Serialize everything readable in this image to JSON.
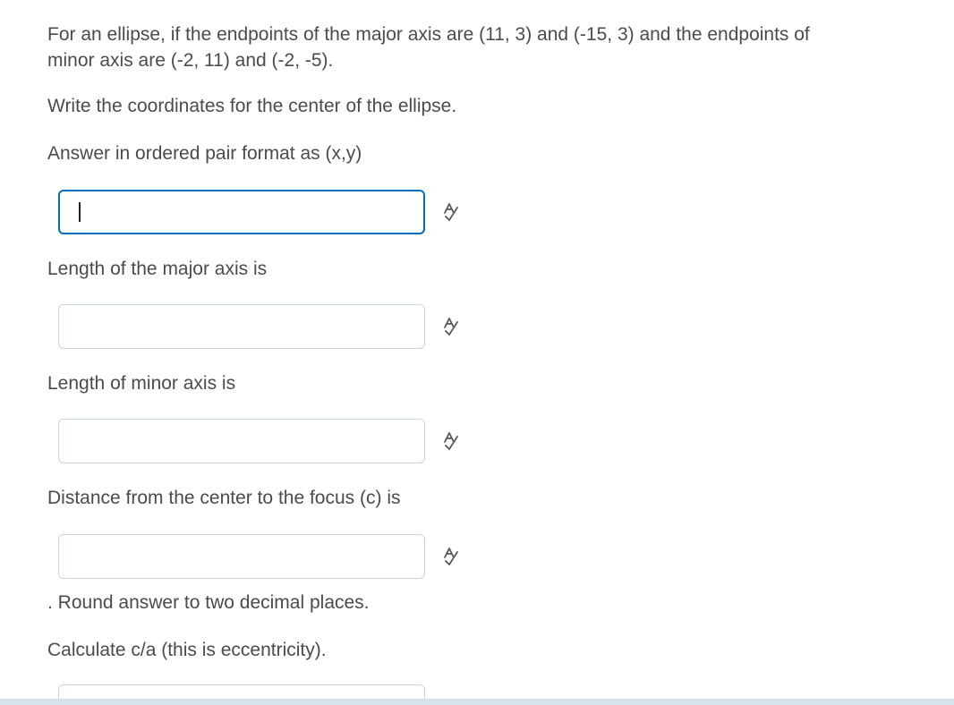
{
  "question": {
    "intro": "For an ellipse, if the endpoints of the major axis are (11, 3) and (-15, 3) and the endpoints of minor axis are (-2, 11) and (-2, -5).",
    "center_prompt": "Write the coordinates for the center of the ellipse.",
    "format_prompt": "Answer in ordered pair format as (x,y)",
    "major_prompt": "Length of the major axis is",
    "minor_prompt": "Length of minor axis is",
    "focus_prompt": "Distance from the center to the focus (c) is",
    "round_note": ". Round answer to two decimal places.",
    "eccentricity_prompt": "Calculate c/a (this is eccentricity)."
  },
  "answers": {
    "center": {
      "value": "",
      "focused": true
    },
    "major": {
      "value": ""
    },
    "minor": {
      "value": ""
    },
    "focus": {
      "value": ""
    },
    "eccentricity": {
      "value": ""
    }
  },
  "icons": {
    "equation_editor": "equation-editor-icon"
  },
  "colors": {
    "text": "#494c4e",
    "focus_border": "#006fbf",
    "input_border": "#cdd5dc"
  }
}
